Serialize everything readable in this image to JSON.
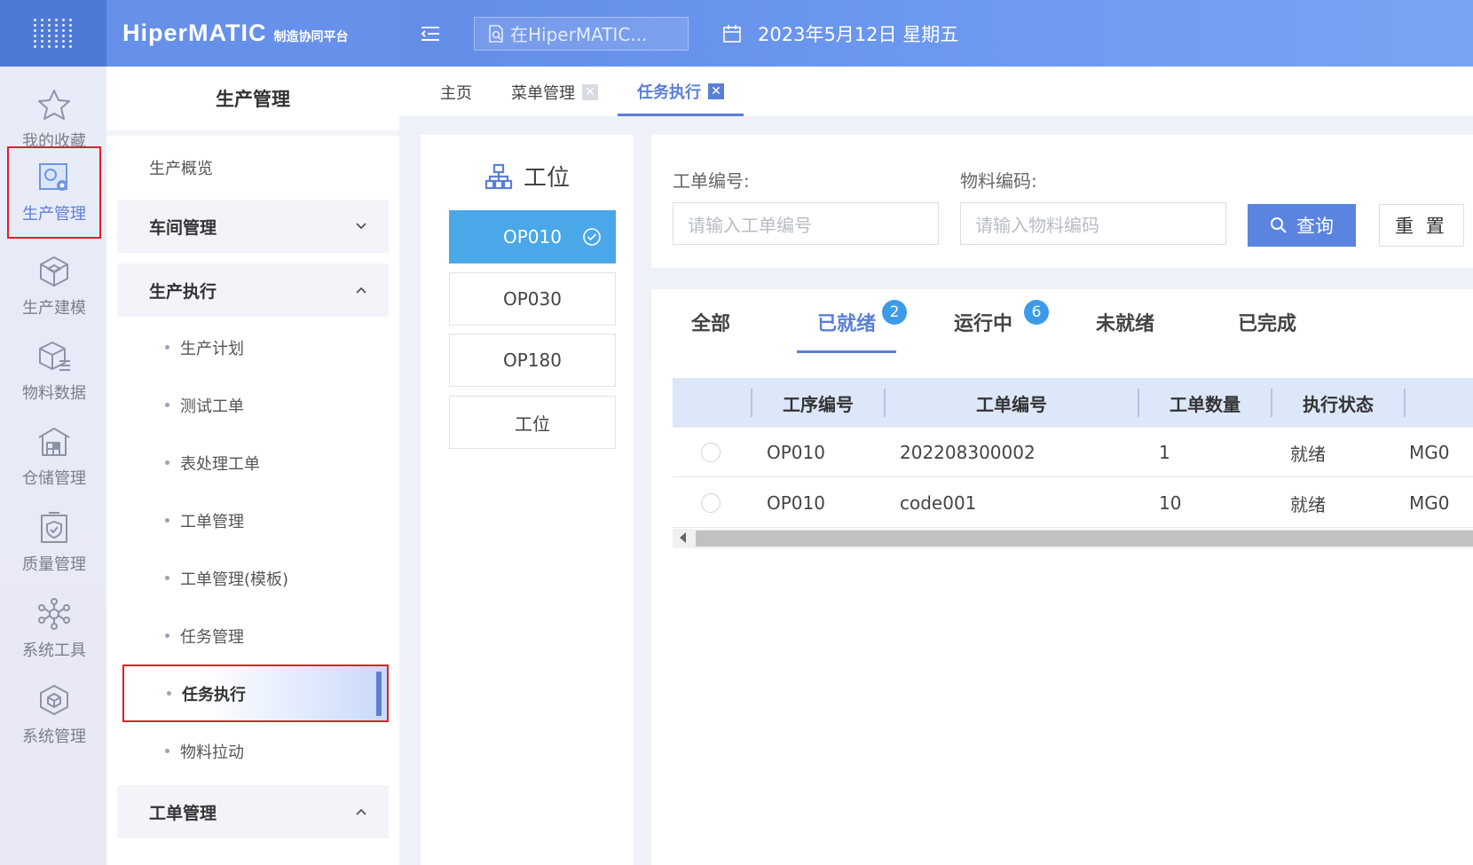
{
  "header": {
    "logo_main": "HiperMATIC",
    "logo_sub": "制造协同平台",
    "search_placeholder": "在HiperMATIC...",
    "date": "2023年5月12日 星期五"
  },
  "rail": {
    "items": [
      {
        "label": "我的收藏",
        "icon": "star-icon"
      },
      {
        "label": "生产管理",
        "icon": "production-icon"
      },
      {
        "label": "生产建模",
        "icon": "cube-icon"
      },
      {
        "label": "物料数据",
        "icon": "box-list-icon"
      },
      {
        "label": "仓储管理",
        "icon": "warehouse-icon"
      },
      {
        "label": "质量管理",
        "icon": "shield-icon"
      },
      {
        "label": "系统工具",
        "icon": "network-icon"
      },
      {
        "label": "系统管理",
        "icon": "cube-settings-icon"
      }
    ]
  },
  "submenu": {
    "title": "生产管理",
    "overview": "生产概览",
    "group_workshop": "车间管理",
    "group_exec": "生产执行",
    "leaves": [
      "生产计划",
      "测试工单",
      "表处理工单",
      "工单管理",
      "工单管理(模板)",
      "任务管理",
      "任务执行",
      "物料拉动"
    ],
    "group_order": "工单管理"
  },
  "tabs": [
    {
      "label": "主页"
    },
    {
      "label": "菜单管理"
    },
    {
      "label": "任务执行"
    }
  ],
  "workstations": {
    "title": "工位",
    "items": [
      "OP010",
      "OP030",
      "OP180",
      "工位"
    ]
  },
  "filter": {
    "order_label": "工单编号:",
    "order_placeholder": "请输入工单编号",
    "material_label": "物料编码:",
    "material_placeholder": "请输入物料编码",
    "query_label": "查询",
    "reset_label": "重 置"
  },
  "status_tabs": [
    {
      "label": "全部"
    },
    {
      "label": "已就绪",
      "badge": "2"
    },
    {
      "label": "运行中",
      "badge": "6"
    },
    {
      "label": "未就绪"
    },
    {
      "label": "已完成"
    }
  ],
  "table": {
    "headers": [
      "工序编号",
      "工单编号",
      "工单数量",
      "执行状态"
    ],
    "rows": [
      {
        "op": "OP010",
        "order": "202208300002",
        "qty": "1",
        "status": "就绪",
        "extra": "MG0"
      },
      {
        "op": "OP010",
        "order": "code001",
        "qty": "10",
        "status": "就绪",
        "extra": "MG0"
      }
    ]
  },
  "colors": {
    "accent": "#5b7fd8",
    "highlight_border": "#e0202a",
    "active_workstation": "#4aa7e8"
  }
}
